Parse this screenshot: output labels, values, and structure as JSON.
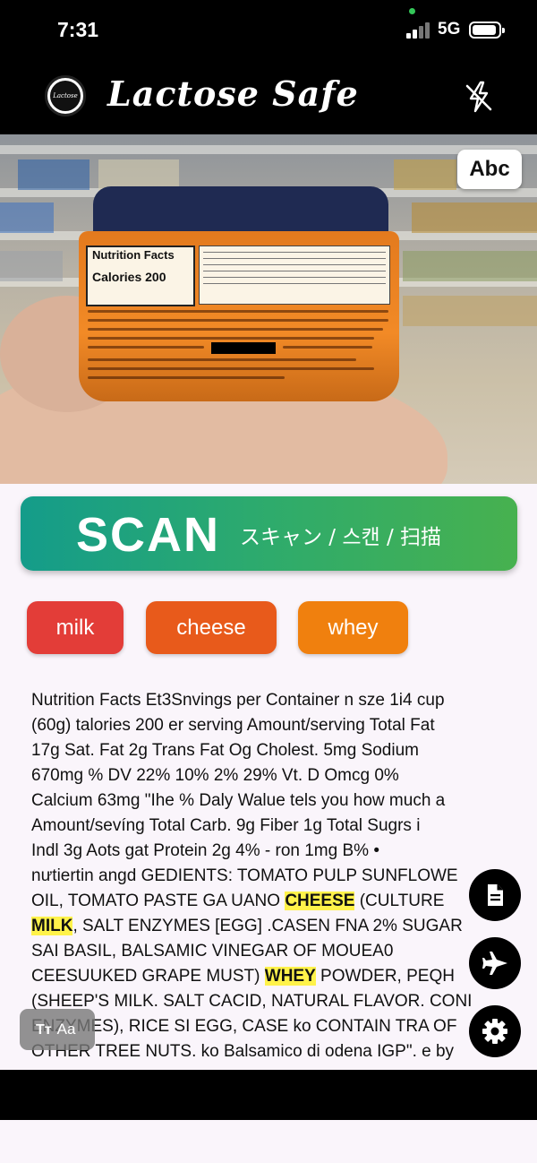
{
  "status_bar": {
    "time": "7:31",
    "network": "5G"
  },
  "header": {
    "title": "Lactose Safe",
    "logo_text": "Lactose Safe"
  },
  "camera": {
    "abc_label": "Abc",
    "label_text": {
      "nf_title": "Nutrition Facts",
      "calories": "Calories 200"
    }
  },
  "scan_button": {
    "label": "SCAN",
    "sublabel": "スキャン / 스캔 / 扫描"
  },
  "allergen_chips": [
    {
      "label": "milk",
      "color": "#e33d38"
    },
    {
      "label": "cheese",
      "color": "#e85a1b"
    },
    {
      "label": "whey",
      "color": "#f0800e"
    }
  ],
  "ocr": {
    "lines": [
      [
        {
          "t": "Nutrition Facts Et3Snvings per Container n sze 1i4 cup"
        }
      ],
      [
        {
          "t": "(60g) talories 200 er serving Amount/serving Total Fat"
        }
      ],
      [
        {
          "t": "17g Sat. Fat 2g Trans Fat Og Cholest. 5mg Sodium"
        }
      ],
      [
        {
          "t": "670mg % DV 22% 10% 2% 29% Vt. D Omcg 0%"
        }
      ],
      [
        {
          "t": "Calcium 63mg \"Ihe % Daly Walue tels you how much a"
        }
      ],
      [
        {
          "t": "Amount/sevíng Total Carb. 9g Fiber 1g Total Sugrs i"
        }
      ],
      [
        {
          "t": "Indl 3g Aots gat Protein 2g 4% - ron 1mg B% •"
        }
      ],
      [
        {
          "t": "nưtiertin angd GEDIENTS: TOMATO PULP SUNFLOWE"
        }
      ],
      [
        {
          "t": "OIL, TOMATO PASTE GA UANO "
        },
        {
          "t": "CHEESE",
          "hl": true
        },
        {
          "t": " (CULTURE"
        }
      ],
      [
        {
          "t": "MILK",
          "hl": true
        },
        {
          "t": ", SALT ENZYMES [EGG] .CASEN FNA 2% SUGAR"
        }
      ],
      [
        {
          "t": "SAI BASIL, BALSAMIC VINEGAR OF MOUEA0"
        }
      ],
      [
        {
          "t": "CEESUUKED GRAPE MUST) "
        },
        {
          "t": "WHEY",
          "hl": true
        },
        {
          "t": " POWDER, PEQH"
        }
      ],
      [
        {
          "t": "(SHEEP'S MILK. SALT CACID, NATURAL FLAVOR. CONI"
        }
      ],
      [
        {
          "t": "ENZYMES), RICE SI EGG, CASE ko CONTAIN TRA OF"
        }
      ],
      [
        {
          "t": "OTHER TREE NUTS. ko Balsamico di odena IGP\". e by"
        }
      ]
    ],
    "highlight_color": "#fff24a"
  },
  "fabs": [
    {
      "icon": "document-icon"
    },
    {
      "icon": "airplane-icon"
    },
    {
      "icon": "gear-icon"
    }
  ],
  "text_size_button": {
    "icon_label": "Tт",
    "label": "Aa"
  },
  "colors": {
    "scan_gradient_start": "#149c8a",
    "scan_gradient_end": "#47b14f",
    "background": "#faf5fb"
  }
}
